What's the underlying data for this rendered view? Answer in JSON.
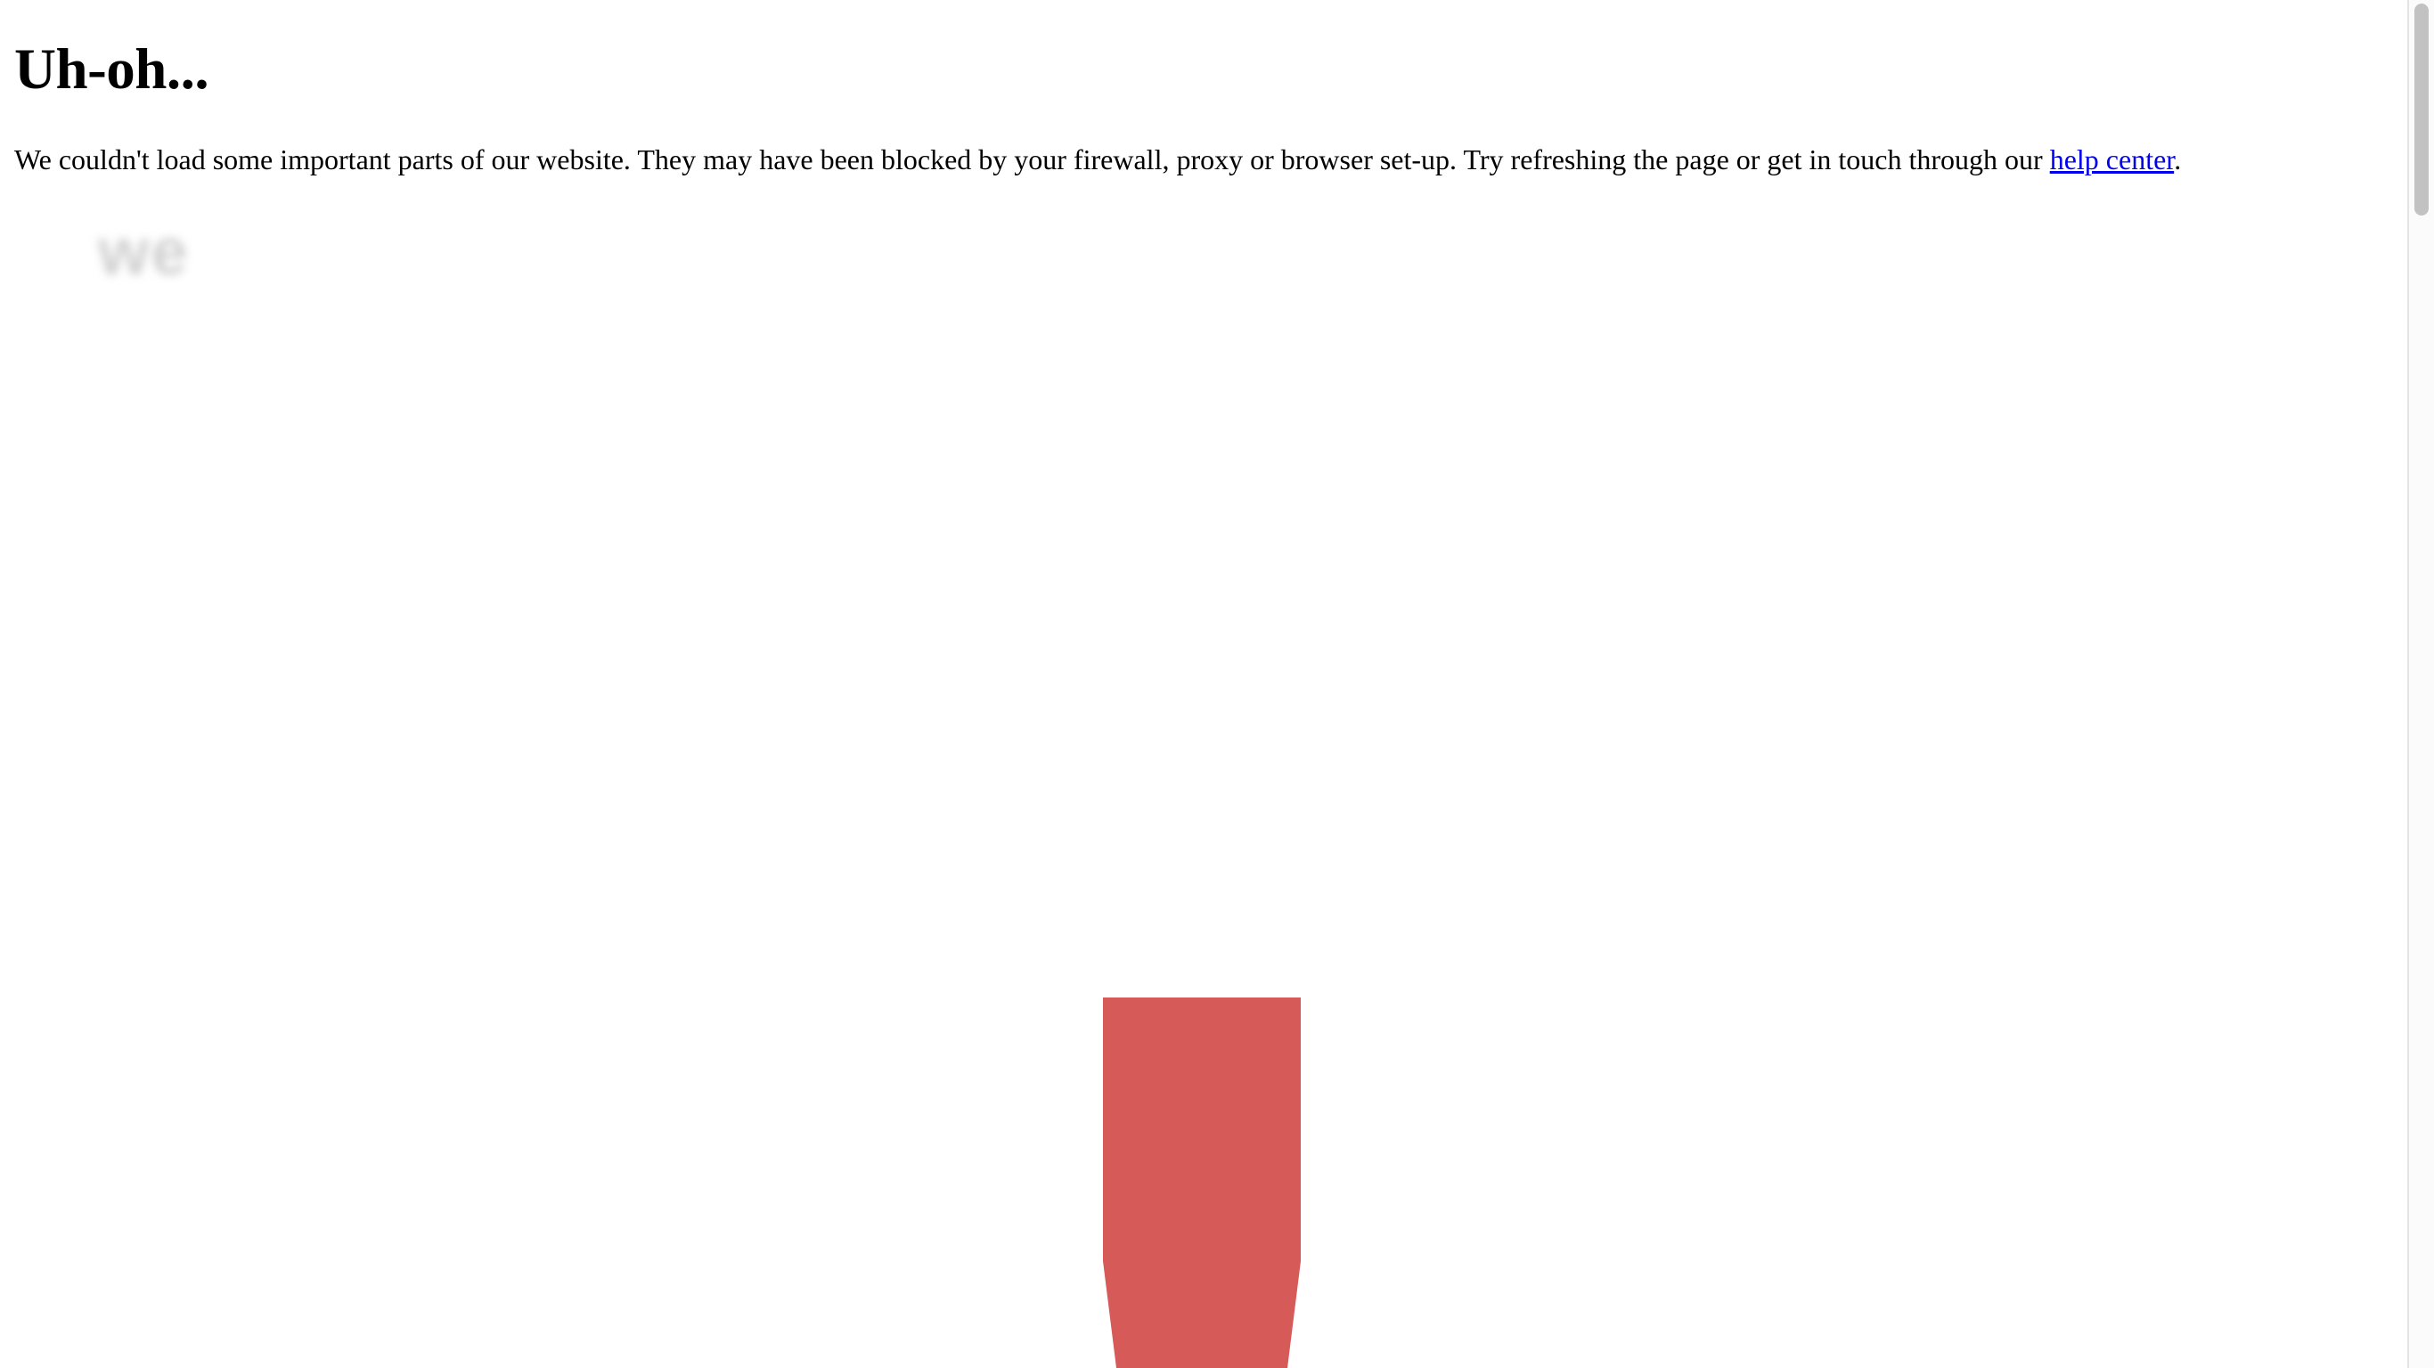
{
  "error": {
    "title": "Uh-oh...",
    "message": "We couldn't load some important parts of our website. They may have been blocked by your firewall, proxy or browser set-up. Try refreshing the page or get in touch through our ",
    "link_text": "help center",
    "message_end": "."
  },
  "logo": {
    "text": "we"
  },
  "colors": {
    "accent_red": "#d65a57",
    "link": "#0000ee",
    "logo_gray": "#c8c8c8"
  }
}
